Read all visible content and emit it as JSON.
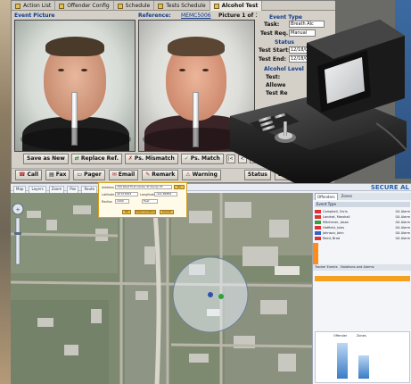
{
  "client": {
    "tabs": [
      {
        "label": "Action List",
        "active": false
      },
      {
        "label": "Offender Config",
        "active": false
      },
      {
        "label": "Schedule",
        "active": false
      },
      {
        "label": "Tests Schedule",
        "active": false
      },
      {
        "label": "Alcohol Test",
        "active": true
      }
    ],
    "event_picture_label": "Event Picture",
    "reference_label": "Reference:",
    "reference_id": "MEMC5006",
    "picture_counter": "Picture 1 of 1",
    "event_type_header": "Event Type",
    "task_label": "Task:",
    "task_value": "Breath Alc",
    "test_req_label": "Test Req.",
    "test_req_value": "Manual",
    "status_header": "Status",
    "test_start_label": "Test Start:",
    "test_start_value": "12/18/08",
    "test_end_label": "Test End:",
    "test_end_value": "12/18/08",
    "alcohol_level_header": "Alcohol Level",
    "alcohol_rows": [
      "Test:",
      "Allowe",
      "Test Re"
    ],
    "buttons": {
      "save_new": "Save as New",
      "replace_ref": "Replace Ref.",
      "ps_mismatch": "Ps. Mismatch",
      "ps_match": "Ps. Match"
    },
    "nav_buttons": [
      "|<",
      "<",
      ">",
      ">|"
    ],
    "toolbar2": {
      "call": "Call",
      "fax": "Fax",
      "pager": "Pager",
      "email": "Email",
      "remark": "Remark",
      "warning": "Warning",
      "status": "Status",
      "bat": "BAT"
    }
  },
  "map_app": {
    "brand": "SECURE AL",
    "buttons": [
      "Map",
      "Layers",
      "Zoom",
      "Pan",
      "Route",
      "Print"
    ],
    "popup": {
      "address_label": "Address",
      "address_value": "700 West First Center St Sandy UT",
      "latitude_label": "Latitude",
      "latitude_value": "40.571843",
      "longitude_label": "Longitude",
      "longitude_value": "-111.89654",
      "radius_label": "Radius",
      "radius_value": "1000",
      "units_value": "Feet",
      "go_label": "Go",
      "ok_label": "OK",
      "clear_label": "Clear Location",
      "cancel_label": "Cancel"
    },
    "side_tabs": [
      "Offenders",
      "Zones"
    ],
    "offender_rows": [
      {
        "name": "Campbell, Chris",
        "status": "GA Alarm",
        "color": "#e03030"
      },
      {
        "name": "Landrat, Marshall",
        "status": "GA Alarm",
        "color": "#e03030"
      },
      {
        "name": "Mitchener, Jason",
        "status": "GA Alarm",
        "color": "#30a040"
      },
      {
        "name": "Hatfield, Jules",
        "status": "GA Alarm",
        "color": "#e03030"
      },
      {
        "name": "Johnson, John",
        "status": "GA Alarm",
        "color": "#3060d0"
      },
      {
        "name": "Reed, Brad",
        "status": "GA Alarm",
        "color": "#e03030"
      }
    ],
    "sub_tabs": [
      "Tracker Events",
      "Violations and Alarms"
    ],
    "list_header": "Event Type",
    "chart_labels": [
      "Offender",
      "Zones"
    ]
  },
  "colors": {
    "client_bg": "#d4d0c8",
    "link_blue": "#103c8c",
    "accent_orange": "#f6a020",
    "map_blue": "#2060b0"
  }
}
